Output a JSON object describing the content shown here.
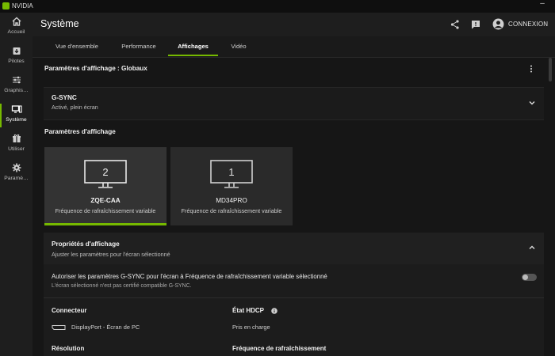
{
  "app": {
    "title": "NVIDIA",
    "minimize_glyph": "–"
  },
  "sidebar": {
    "items": [
      {
        "label": "Accueil",
        "icon": "home-icon"
      },
      {
        "label": "Pilotes",
        "icon": "driver-icon"
      },
      {
        "label": "Graphis…",
        "icon": "sliders-icon"
      },
      {
        "label": "Système",
        "icon": "monitor-icon",
        "active": true
      },
      {
        "label": "Utiliser",
        "icon": "gift-icon"
      },
      {
        "label": "Paramè…",
        "icon": "gear-icon"
      }
    ]
  },
  "header": {
    "title": "Système",
    "share_icon": "share-icon",
    "feedback_icon": "feedback-icon",
    "account_icon": "avatar-icon",
    "connexion": "CONNEXION"
  },
  "tabs": [
    {
      "label": "Vue d'ensemble"
    },
    {
      "label": "Performance"
    },
    {
      "label": "Affichages",
      "active": true
    },
    {
      "label": "Vidéo"
    }
  ],
  "display_settings": {
    "title": "Paramètres d'affichage : Globaux",
    "gsync": {
      "title": "G-SYNC",
      "status": "Activé, plein écran"
    },
    "section_title": "Paramètres d'affichage",
    "monitors": [
      {
        "number": "2",
        "name": "ZQE-CAA",
        "desc": "Fréquence de rafraîchissement variable",
        "selected": true
      },
      {
        "number": "1",
        "name": "MD34PRO",
        "desc": "Fréquence de rafraîchissement variable",
        "selected": false
      }
    ],
    "properties": {
      "title": "Propriétés d'affichage",
      "subtitle": "Ajuster les paramètres pour l'écran sélectionné",
      "gsync_setting_title": "Autoriser les paramètres G-SYNC pour l'écran à Fréquence de rafraîchissement variable sélectionné",
      "gsync_setting_sub": "L'écran sélectionné n'est pas certifié compatible G-SYNC.",
      "gsync_toggle_on": false,
      "connector_label": "Connecteur",
      "connector_value": "DisplayPort - Écran de PC",
      "hdcp_label": "État HDCP",
      "hdcp_value": "Pris en charge",
      "resolution_label": "Résolution",
      "refresh_label": "Fréquence de rafraîchissement"
    }
  },
  "colors": {
    "accent": "#76b900",
    "background": "#161616",
    "panel": "#1e1e1e"
  }
}
